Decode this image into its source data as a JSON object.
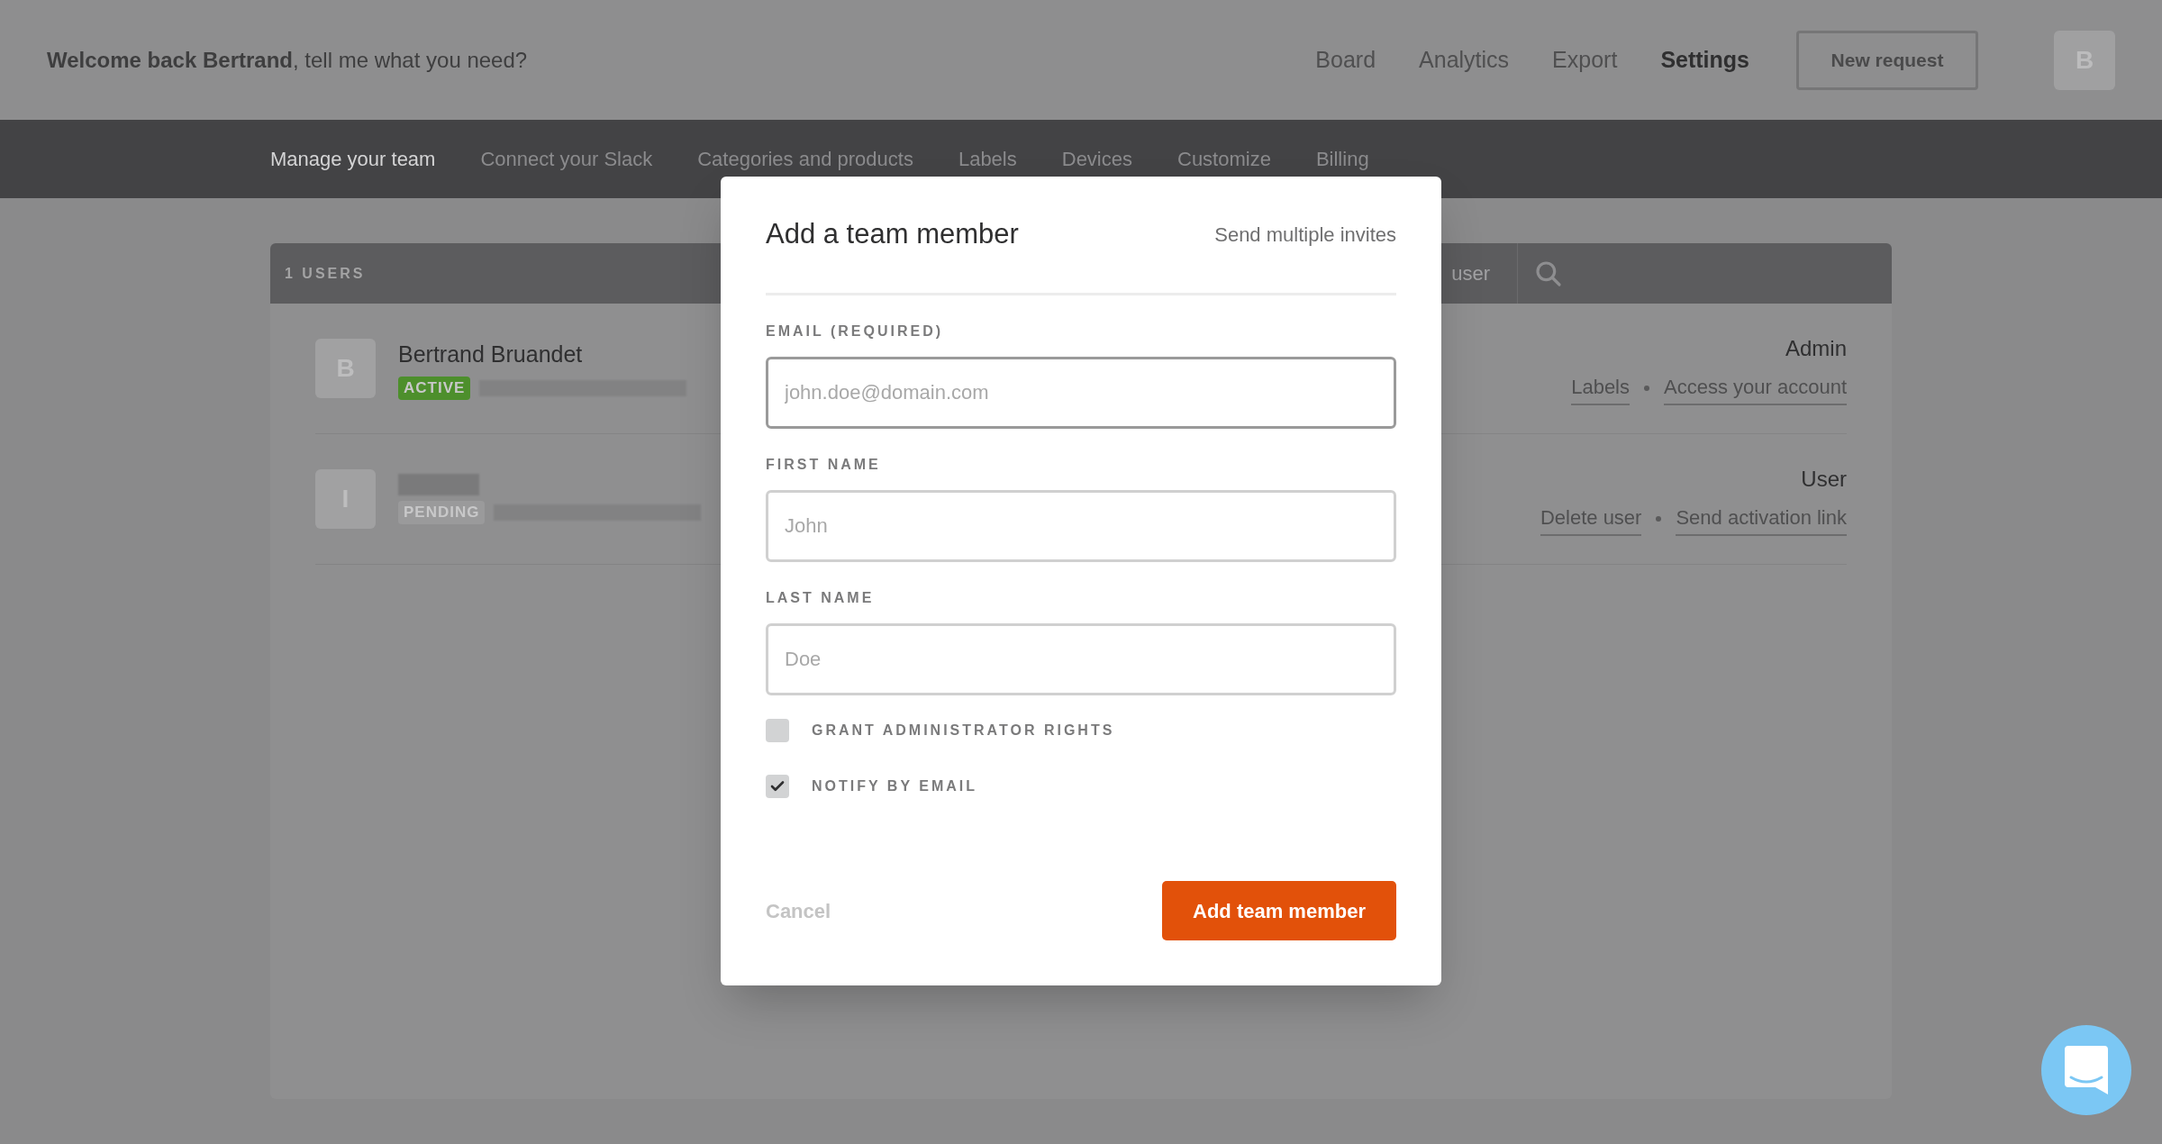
{
  "header": {
    "welcome": "**Welcome back Bertrand**, tell me what you need?",
    "nav": [
      {
        "label": "Board",
        "selected": false
      },
      {
        "label": "Analytics",
        "selected": false
      },
      {
        "label": "Export",
        "selected": false
      },
      {
        "label": "Settings",
        "selected": true
      }
    ],
    "new_request_button": "New request",
    "avatar": "B"
  },
  "subnav": [
    {
      "label": "Manage your team",
      "selected": true
    },
    {
      "label": "Connect your Slack",
      "selected": false
    },
    {
      "label": "Categories and products",
      "selected": false
    },
    {
      "label": "Labels",
      "selected": false
    },
    {
      "label": "Devices",
      "selected": false
    },
    {
      "label": "Customize",
      "selected": false
    },
    {
      "label": "Billing",
      "selected": false
    }
  ],
  "users_table": {
    "count_label": "1 USERS",
    "search_placeholder": "user",
    "rows": [
      {
        "avatar": "B",
        "name": "Bertrand Bruandet",
        "status": "ACTIVE",
        "color": "#4d8f2c",
        "role": "Admin",
        "actions": [
          "Labels",
          "Access your account"
        ]
      },
      {
        "avatar": "I",
        "status": "PENDING",
        "color": "#9a9a9b",
        "role": "User",
        "actions": [
          "Delete user",
          "Send activation link"
        ]
      }
    ]
  },
  "modal": {
    "title": "Add a team member",
    "link": "Send multiple invites",
    "fields": [
      {
        "label": "EMAIL (REQUIRED)",
        "placeholder": "john.doe@domain.com",
        "focused": true
      },
      {
        "label": "FIRST NAME",
        "placeholder": "John",
        "focused": false
      },
      {
        "label": "LAST NAME",
        "placeholder": "Doe",
        "focused": false
      }
    ],
    "checkboxes": [
      {
        "label": "GRANT ADMINISTRATOR RIGHTS",
        "checked": false
      },
      {
        "label": "NOTIFY BY EMAIL",
        "checked": true
      }
    ],
    "cancel": "Cancel",
    "submit": "Add team member"
  }
}
